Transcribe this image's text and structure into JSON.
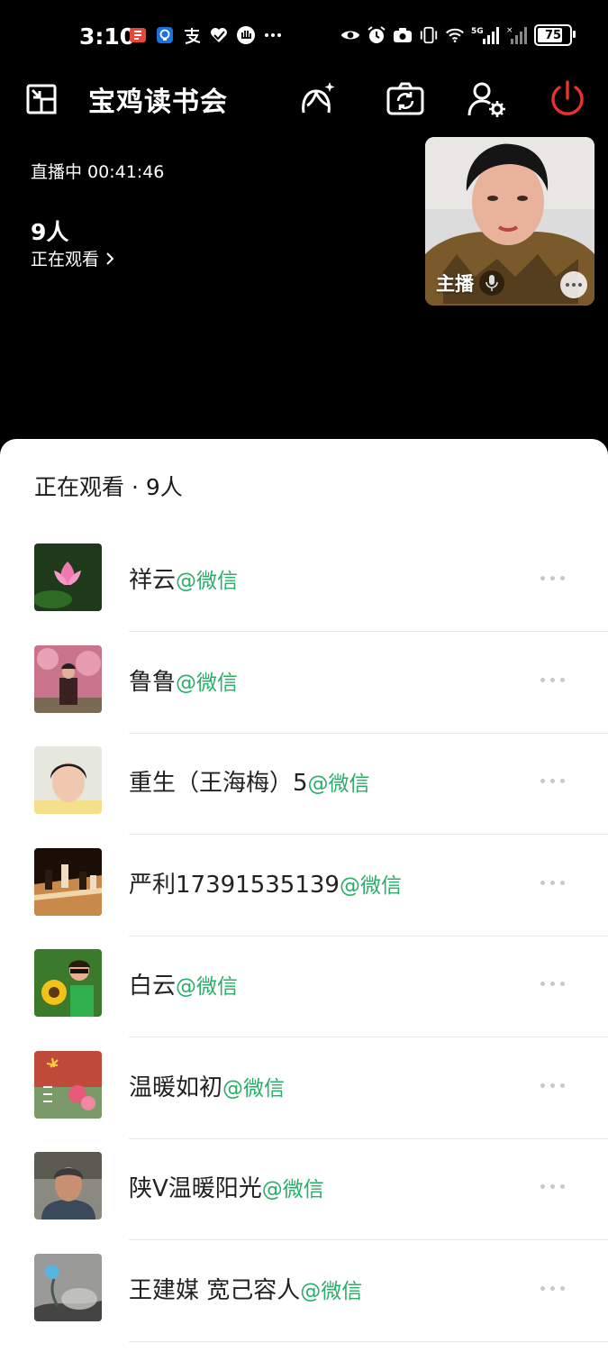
{
  "status_bar": {
    "time": "3:10",
    "left_icons": [
      "book-app-icon",
      "lightbulb-app-icon",
      "alipay-icon",
      "heart-app-icon",
      "hand-app-icon",
      "more-icon"
    ],
    "right_icons": [
      "eye-icon",
      "alarm-icon",
      "camera-icon",
      "vibrate-icon",
      "wifi-icon",
      "signal-5g-icon",
      "signal-icon"
    ],
    "battery": "75"
  },
  "topbar": {
    "room_title": "宝鸡读书会"
  },
  "live": {
    "status_text": "直播中 00:41:46",
    "viewer_count": "9人",
    "viewer_link": "正在观看"
  },
  "host_card": {
    "label": "主播"
  },
  "sheet": {
    "title": "正在观看 · 9人",
    "viewers": [
      {
        "name": "祥云",
        "source": "@微信"
      },
      {
        "name": "鲁鲁",
        "source": "@微信"
      },
      {
        "name": "重生（王海梅）5",
        "source": "@微信"
      },
      {
        "name": "严利17391535139",
        "source": "@微信"
      },
      {
        "name": "白云",
        "source": "@微信"
      },
      {
        "name": "温暖如初",
        "source": "@微信"
      },
      {
        "name": "陕V温暖阳光",
        "source": "@微信"
      },
      {
        "name": "王建媒 宽己容人",
        "source": "@微信"
      }
    ]
  },
  "colors": {
    "background": "#000000",
    "sheet": "#ffffff",
    "accent_green": "#2aae67",
    "end_red": "#e8322c"
  }
}
